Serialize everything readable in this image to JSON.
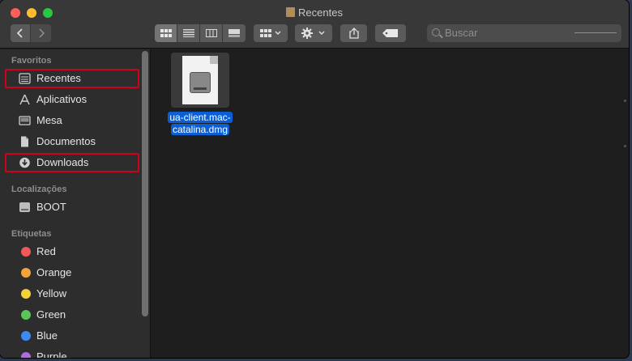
{
  "window": {
    "title": "Recentes"
  },
  "toolbar": {
    "back_icon": "chevron-left-icon",
    "forward_icon": "chevron-right-icon",
    "view_icons": [
      "icon-view-icon",
      "list-view-icon",
      "column-view-icon",
      "gallery-view-icon"
    ],
    "active_view": "icon-view",
    "group_icon": "group-icon",
    "action_icon": "gear-icon",
    "share_icon": "share-icon",
    "tag_icon": "tag-icon",
    "search_placeholder": "Buscar"
  },
  "sidebar": {
    "sections": [
      {
        "title": "Favoritos",
        "items": [
          {
            "label": "Recentes",
            "icon": "recents-icon",
            "highlighted": true
          },
          {
            "label": "Aplicativos",
            "icon": "applications-icon"
          },
          {
            "label": "Mesa",
            "icon": "desktop-icon"
          },
          {
            "label": "Documentos",
            "icon": "documents-icon"
          },
          {
            "label": "Downloads",
            "icon": "downloads-icon",
            "highlighted": true
          }
        ]
      },
      {
        "title": "Localizações",
        "items": [
          {
            "label": "BOOT",
            "icon": "hard-drive-icon"
          }
        ]
      },
      {
        "title": "Etiquetas",
        "items": [
          {
            "label": "Red",
            "color": "#f0585a"
          },
          {
            "label": "Orange",
            "color": "#f5a33a"
          },
          {
            "label": "Yellow",
            "color": "#f5d23a"
          },
          {
            "label": "Green",
            "color": "#5ac65a"
          },
          {
            "label": "Blue",
            "color": "#3b8cf0"
          },
          {
            "label": "Purple",
            "color": "#b36ae0"
          }
        ]
      }
    ]
  },
  "files": [
    {
      "name_line1": "ua-client.mac-",
      "name_line2": "catalina.dmg",
      "icon": "dmg-disk-image-icon",
      "selected": true
    }
  ],
  "colors": {
    "highlight_border": "#d0021b",
    "selection": "#0a5fd6"
  }
}
